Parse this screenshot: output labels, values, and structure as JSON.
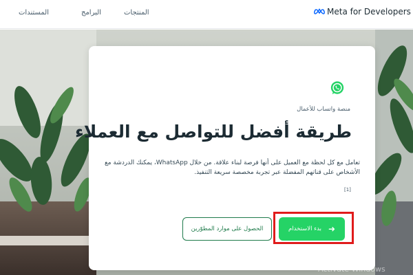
{
  "header": {
    "brand": "Meta for Developers",
    "nav": {
      "products": "المنتجات",
      "programs": "البرامج",
      "docs": "المستندات"
    }
  },
  "card": {
    "eyebrow": "منصة واتساب للأعمال",
    "headline": "طريقة أفضل للتواصل مع العملاء",
    "description": "تعامل مع كل لحظة مع العميل على أنها فرصة لبناء علاقة. من خلال WhatsApp، يمكنك الدردشة مع الأشخاص على قناتهم المفضلة عبر تجربة مخصصة سريعة التنفيذ.",
    "footnote": "[1]",
    "primary_button": "بدء الاستخدام",
    "secondary_button": "الحصول على موارد المطوّرين"
  },
  "watermark": "Activate Windows",
  "colors": {
    "whatsapp_green": "#25d366",
    "outline_green": "#1e7a4a",
    "highlight_red": "#e01b1b",
    "meta_blue": "#0866ff"
  },
  "icons": {
    "brand": "meta-logo-icon",
    "card": "whatsapp-icon",
    "primary_button": "arrow-right-icon"
  }
}
